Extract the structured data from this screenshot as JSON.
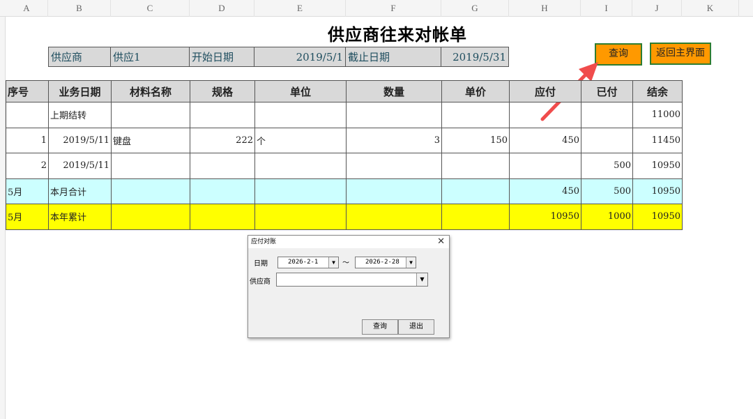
{
  "columns": [
    "A",
    "B",
    "C",
    "D",
    "E",
    "F",
    "G",
    "H",
    "I",
    "J",
    "K"
  ],
  "sheet": {
    "title": "供应商往来对帐单",
    "header_row": {
      "supplier_label": "供应商",
      "supplier_value": "供应1",
      "start_label": "开始日期",
      "start_value": "2019/5/1",
      "end_label": "截止日期",
      "end_value": "2019/5/31"
    },
    "buttons": {
      "query": "查询",
      "back": "返回主界面"
    },
    "table_headers": [
      "序号",
      "业务日期",
      "材料名称",
      "规格",
      "单位",
      "数量",
      "单价",
      "应付",
      "已付",
      "结余"
    ],
    "rows": [
      [
        "",
        "上期结转",
        "",
        "",
        "",
        "",
        "",
        "",
        "",
        "11000"
      ],
      [
        "1",
        "2019/5/11",
        "键盘",
        "222",
        "个",
        "3",
        "150",
        "450",
        "",
        "11450"
      ],
      [
        "2",
        "2019/5/11",
        "",
        "",
        "",
        "",
        "",
        "",
        "500",
        "10950"
      ],
      [
        "5月",
        "本月合计",
        "",
        "",
        "",
        "",
        "",
        "450",
        "500",
        "10950"
      ],
      [
        "5月",
        "本年累计",
        "",
        "",
        "",
        "",
        "",
        "10950",
        "1000",
        "10950"
      ]
    ]
  },
  "dialog": {
    "title": "应付对账",
    "date_label": "日期",
    "date_from": "2026-2-1",
    "tilde": "～",
    "date_to": "2026-2-28",
    "supplier_label": "供应商",
    "supplier_value": "",
    "query_button": "查询",
    "exit_button": "退出"
  },
  "colors": {
    "header_gray": "#d9d9d9",
    "button_orange": "#ff9900",
    "button_border_green": "#2e7d32",
    "row_cyan": "#ccffff",
    "row_yellow": "#ffff00",
    "arrow_red": "#f04c4c"
  }
}
